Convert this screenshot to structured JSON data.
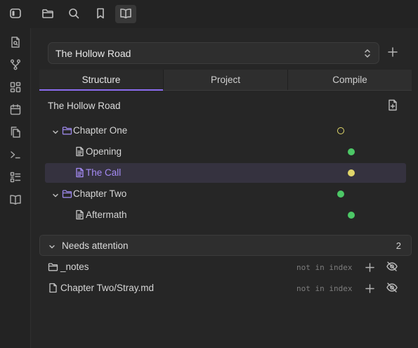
{
  "top_toolbar": {
    "icons": [
      "sidebar-toggle-icon",
      "folder-icon",
      "search-icon",
      "bookmark-icon",
      "book-open-icon"
    ],
    "active": "book-open-icon"
  },
  "ribbon": {
    "icons": [
      "file-search-icon",
      "git-branch-icon",
      "layout-grid-icon",
      "calendar-icon",
      "copy-files-icon",
      "terminal-icon",
      "checklist-icon",
      "book-open-icon"
    ]
  },
  "project_select": {
    "value": "The Hollow Road"
  },
  "tabs": [
    {
      "label": "Structure",
      "active": true
    },
    {
      "label": "Project",
      "active": false
    },
    {
      "label": "Compile",
      "active": false
    }
  ],
  "structure": {
    "project_title": "The Hollow Road",
    "tree": [
      {
        "type": "folder",
        "label": "Chapter One",
        "status": "outline",
        "status_color": "#e2d96b"
      },
      {
        "type": "file",
        "label": "Opening",
        "status": "filled",
        "status_color": "#4cc766"
      },
      {
        "type": "file",
        "label": "The Call",
        "status": "filled",
        "status_color": "#e0d56a",
        "selected": true
      },
      {
        "type": "folder",
        "label": "Chapter Two",
        "status": "filled",
        "status_color": "#4cc766"
      },
      {
        "type": "file",
        "label": "Aftermath",
        "status": "filled",
        "status_color": "#4cc766"
      }
    ]
  },
  "needs_attention": {
    "label": "Needs attention",
    "count": "2",
    "items": [
      {
        "type": "folder",
        "label": "_notes",
        "note": "not in index"
      },
      {
        "type": "file",
        "label": "Chapter Two/Stray.md",
        "note": "not in index"
      }
    ]
  },
  "colors": {
    "accent": "#8b6cef",
    "selected_text": "#a58bf5",
    "background": "#262626"
  }
}
